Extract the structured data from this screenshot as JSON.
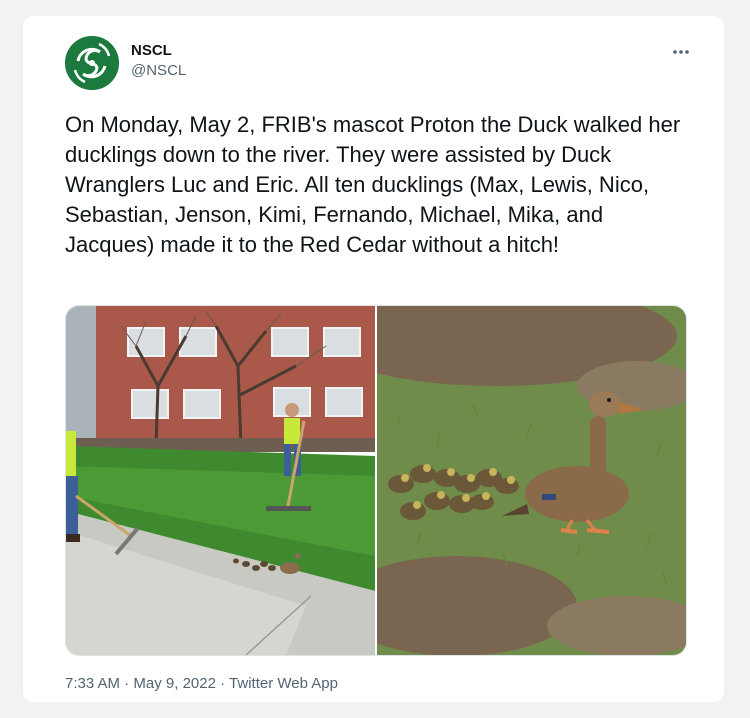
{
  "tweet": {
    "display_name": "NSCL",
    "handle": "@NSCL",
    "more_icon": "more-horizontal-icon",
    "text": "On Monday, May 2, FRIB's mascot Proton the Duck walked her ducklings down to the river. They were assisted by Duck Wranglers Luc and Eric. All ten ducklings (Max, Lewis, Nico, Sebastian, Jenson, Kimi, Fernando, Michael, Mika, and Jacques) made it to the Red Cedar without a hitch!",
    "time": "7:33 AM",
    "separator": "·",
    "date": "May 9, 2022",
    "source": "Twitter Web App"
  },
  "colors": {
    "brand_green": "#1d7a3e",
    "text_primary": "#0f1419",
    "text_secondary": "#536471"
  }
}
